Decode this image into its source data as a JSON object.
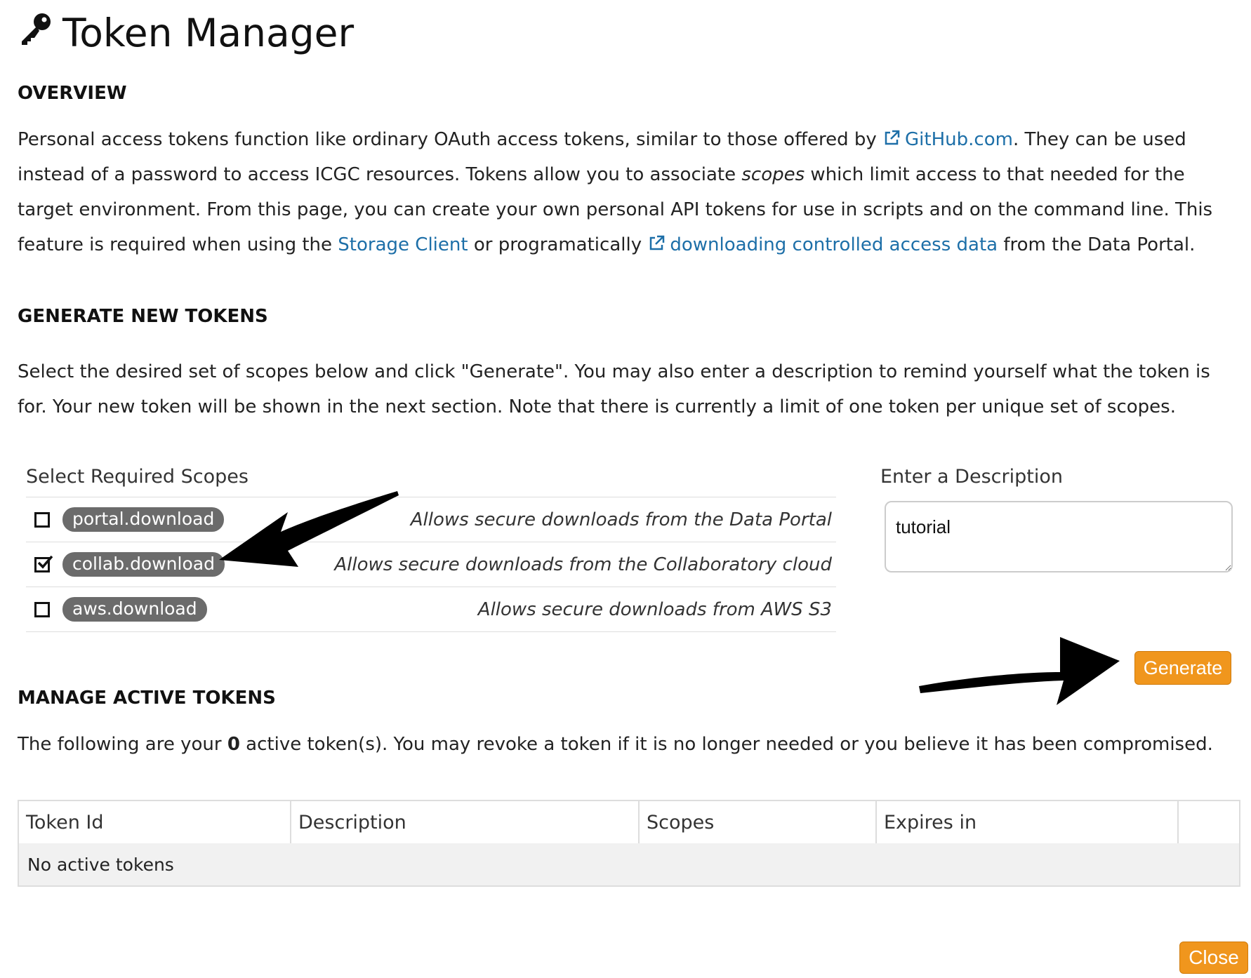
{
  "page": {
    "title": "Token Manager",
    "title_icon": "key-icon"
  },
  "overview": {
    "heading": "OVERVIEW",
    "text_1": "Personal access tokens function like ordinary OAuth access tokens, similar to those offered by ",
    "github_link": "GitHub.com",
    "text_2": ". They can be used instead of a password to access ICGC resources. Tokens allow you to associate ",
    "scopes_word": "scopes",
    "text_3": " which limit access to that needed for the target environment. From this page, you can create your own personal API tokens for use in scripts and on the command line. This feature is required when using the ",
    "storage_link": "Storage Client",
    "text_4": " or programatically ",
    "download_link": "downloading controlled access data",
    "text_5": " from the Data Portal."
  },
  "generate": {
    "heading": "GENERATE NEW TOKENS",
    "text": "Select the desired set of scopes below and click \"Generate\". You may also enter a description to remind yourself what the token is for. Your new token will be shown in the next section. Note that there is currently a limit of one token per unique set of scopes.",
    "scopes_label": "Select Required Scopes",
    "scopes": [
      {
        "name": "portal.download",
        "description": "Allows secure downloads from the Data Portal",
        "checked": false
      },
      {
        "name": "collab.download",
        "description": "Allows secure downloads from the Collaboratory cloud",
        "checked": true
      },
      {
        "name": "aws.download",
        "description": "Allows secure downloads from AWS S3",
        "checked": false
      }
    ],
    "description_label": "Enter a Description",
    "description_value": "tutorial",
    "generate_label": "Generate"
  },
  "manage": {
    "heading": "MANAGE ACTIVE TOKENS",
    "text_1": "The following are your ",
    "count": "0",
    "text_2": " active token(s). You may revoke a token if it is no longer needed or you believe it has been compromised.",
    "columns": [
      "Token Id",
      "Description",
      "Scopes",
      "Expires in",
      ""
    ],
    "empty_message": "No active tokens"
  },
  "footer": {
    "close_label": "Close"
  },
  "colors": {
    "accent": "#f0961d",
    "link": "#1d6fa8",
    "badge": "#6b6b6b"
  }
}
